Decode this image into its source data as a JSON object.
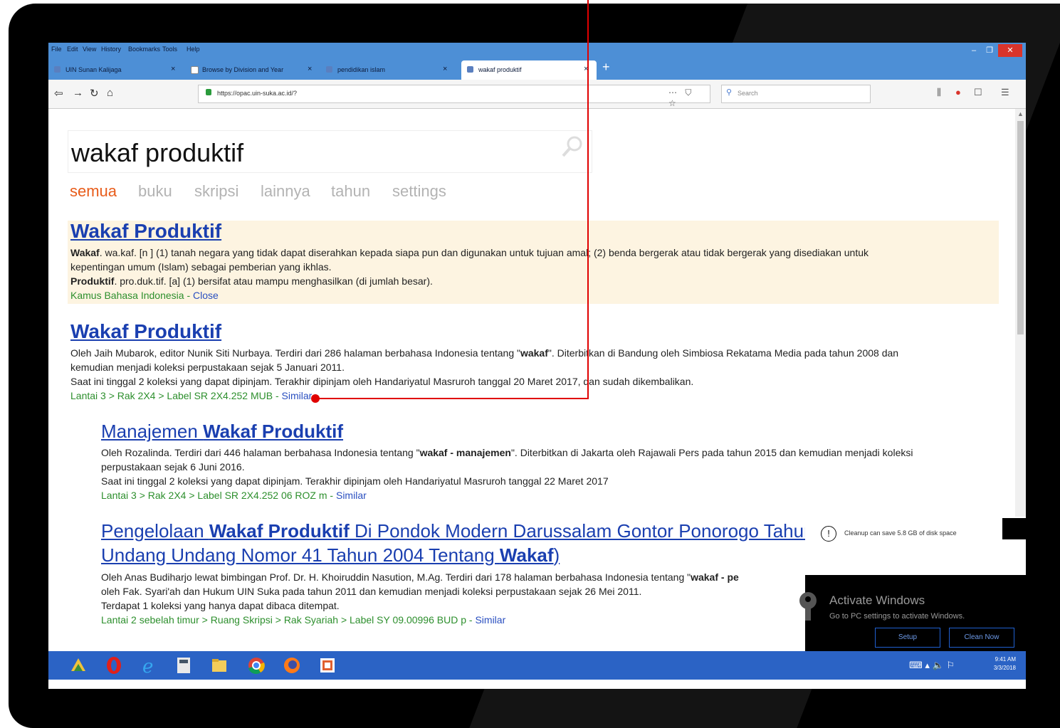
{
  "browser": {
    "menu": [
      "File",
      "Edit",
      "View",
      "History",
      "Bookmarks",
      "Tools",
      "Help"
    ],
    "tabs": [
      {
        "label": "UIN Sunan Kalijaga",
        "close": "×"
      },
      {
        "label": "Browse by Division and Year",
        "close": "×"
      },
      {
        "label": "pendidikan islam",
        "close": "×"
      },
      {
        "label": "wakaf produktif",
        "close": "×"
      }
    ],
    "new_tab": "+",
    "url": "https://opac.uin-suka.ac.id/?",
    "search_placeholder": "Search",
    "page_actions": "⋯ ⛉ ☆"
  },
  "search": {
    "query": "wakaf produktif",
    "filters": [
      "semua",
      "buku",
      "skripsi",
      "lainnya",
      "tahun",
      "settings"
    ]
  },
  "dictionary": {
    "title": "Wakaf Produktif",
    "line1_head": "Wakaf",
    "line1_rest": ". wa.kaf. [n ] (1) tanah negara yang tidak dapat diserahkan kepada siapa pun dan digunakan untuk tujuan amal; (2) benda bergerak atau tidak bergerak yang disediakan untuk",
    "line2": "kepentingan umum (Islam) sebagai pemberian yang ikhlas.",
    "line3_head": "Produktif",
    "line3_rest": ". pro.duk.tif. [a] (1) bersifat atau mampu menghasilkan (di jumlah besar).",
    "source": "Kamus Bahasa Indonesia",
    "sep": " - ",
    "close": "Close"
  },
  "results": [
    {
      "title": "Wakaf Produktif",
      "line1_a": "Oleh Jaih Mubarok, editor Nunik Siti Nurbaya. Terdiri dari 286 halaman berbahasa Indonesia tentang \"",
      "line1_b": "wakaf",
      "line1_c": "\". Diterbitkan di Bandung oleh Simbiosa Rekatama Media pada tahun 2008 dan",
      "line2": "kemudian menjadi koleksi perpustakaan sejak 5 Januari 2011.",
      "line3": "Saat ini tinggal 2 koleksi yang dapat dipinjam. Terakhir dipinjam oleh Handariyatul Masruroh tanggal 20 Maret 2017, dan sudah dikembalikan.",
      "location": "Lantai 3  >  Rak 2X4  >  Label SR 2X4.252 MUB",
      "sep": "  -  ",
      "similar": "Similar"
    },
    {
      "title_a": "Manajemen ",
      "title_b": "Wakaf Produktif",
      "line1_a": "Oleh Rozalinda. Terdiri dari 446 halaman berbahasa Indonesia tentang \"",
      "line1_b": "wakaf - manajemen",
      "line1_c": "\". Diterbitkan di Jakarta oleh Rajawali Pers pada tahun 2015 dan kemudian menjadi koleksi",
      "line2": "perpustakaan sejak 6 Juni 2016.",
      "line3": "Saat ini tinggal 2 koleksi yang dapat dipinjam. Terakhir dipinjam oleh Handariyatul Masruroh tanggal 22 Maret 2017",
      "location": "Lantai 3  >  Rak 2X4  >  Label SR 2X4.252 06 ROZ m",
      "sep": "  -  ",
      "similar": "Similar"
    },
    {
      "title_a": "Pengelolaan ",
      "title_b": "Wakaf Produktif",
      "title_c": " Di Pondok Modern Darussalam Gontor Ponorogo Tahun",
      "title2_a": "Undang Undang Nomor 41 Tahun 2004 Tentang ",
      "title2_b": "Wakaf",
      "title2_c": ")",
      "line1_a": "Oleh Anas Budiharjo lewat bimbingan Prof. Dr. H. Khoiruddin Nasution, M.Ag. Terdiri dari 178 halaman berbahasa Indonesia tentang \"",
      "line1_b": "wakaf - pe",
      "line2": "oleh Fak. Syari'ah dan Hukum UIN Suka pada tahun 2011 dan kemudian menjadi koleksi perpustakaan sejak 26 Mei 2011.",
      "line3": "Terdapat 1 koleksi yang hanya dapat dibaca ditempat.",
      "location": "Lantai 2 sebelah timur  >  Ruang Skripsi  >  Rak Syariah  >  Label SY 09.00996 BUD p",
      "sep": "  -  ",
      "similar": "Similar"
    }
  ],
  "notification": {
    "text": "Cleanup can save 5.8 GB of disk space"
  },
  "activate": {
    "title": "Activate Windows",
    "subtitle": "Go to PC settings to activate Windows.",
    "setup": "Setup",
    "clean": "Clean Now"
  },
  "taskbar": {
    "time": "9:41 AM",
    "date": "3/3/2018"
  },
  "colors": {
    "link": "#1a3fb0",
    "active_filter": "#e85c1a",
    "green_meta": "#2d8f2d",
    "annotation": "#e00000",
    "taskbar": "#2b63c5"
  }
}
